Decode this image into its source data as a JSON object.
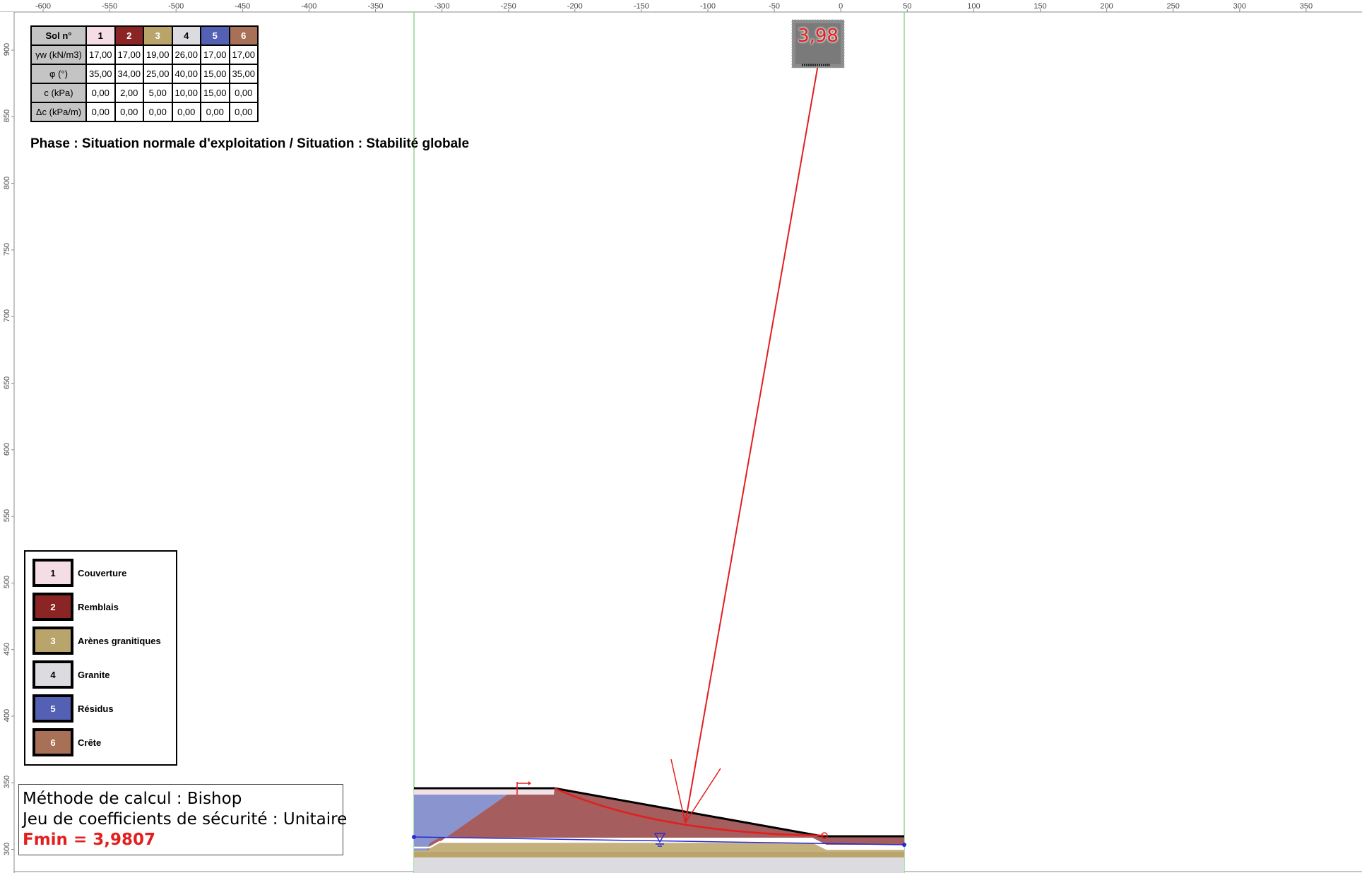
{
  "axis": {
    "x_ticks": [
      "-600",
      "-550",
      "-500",
      "-450",
      "-400",
      "-350",
      "-300",
      "-250",
      "-200",
      "-150",
      "-100",
      "-50",
      "0",
      "50",
      "100",
      "150",
      "200",
      "250",
      "300",
      "350"
    ],
    "y_ticks": [
      "900",
      "850",
      "800",
      "750",
      "700",
      "650",
      "600",
      "550",
      "500",
      "450",
      "400",
      "350",
      "300"
    ]
  },
  "soil_table": {
    "header_label": "Sol n°",
    "soil_numbers": [
      "1",
      "2",
      "3",
      "4",
      "5",
      "6"
    ],
    "soil_colors": [
      "#f5dde6",
      "#8b2525",
      "#b9a46b",
      "#dcdce0",
      "#5460b4",
      "#a87157"
    ],
    "soil_text_colors": [
      "#000",
      "#fff",
      "#fff",
      "#000",
      "#fff",
      "#fff"
    ],
    "rows": [
      {
        "label": "γw (kN/m3)",
        "values": [
          "17,00",
          "17,00",
          "19,00",
          "26,00",
          "17,00",
          "17,00"
        ]
      },
      {
        "label": "φ (°)",
        "values": [
          "35,00",
          "34,00",
          "25,00",
          "40,00",
          "15,00",
          "35,00"
        ]
      },
      {
        "label": "c (kPa)",
        "values": [
          "0,00",
          "2,00",
          "5,00",
          "10,00",
          "15,00",
          "0,00"
        ]
      },
      {
        "label": "Δc (kPa/m)",
        "values": [
          "0,00",
          "0,00",
          "0,00",
          "0,00",
          "0,00",
          "0,00"
        ]
      }
    ]
  },
  "phase_title": "Phase : Situation normale d'exploitation / Situation : Stabilité globale",
  "legend": [
    {
      "num": "1",
      "label": "Couverture"
    },
    {
      "num": "2",
      "label": "Remblais"
    },
    {
      "num": "3",
      "label": "Arènes granitiques"
    },
    {
      "num": "4",
      "label": "Granite"
    },
    {
      "num": "5",
      "label": "Résidus"
    },
    {
      "num": "6",
      "label": "Crête"
    }
  ],
  "method": {
    "line1": "Méthode de calcul : Bishop",
    "line2": "Jeu de coefficients de sécurité : Unitaire",
    "fmin": "Fmin = 3,9807"
  },
  "fos_label": "3,98",
  "colors": {
    "slip_red": "#e31e1e",
    "water_blue": "#2a2ad6",
    "boundary_green": "#8fd68f"
  }
}
